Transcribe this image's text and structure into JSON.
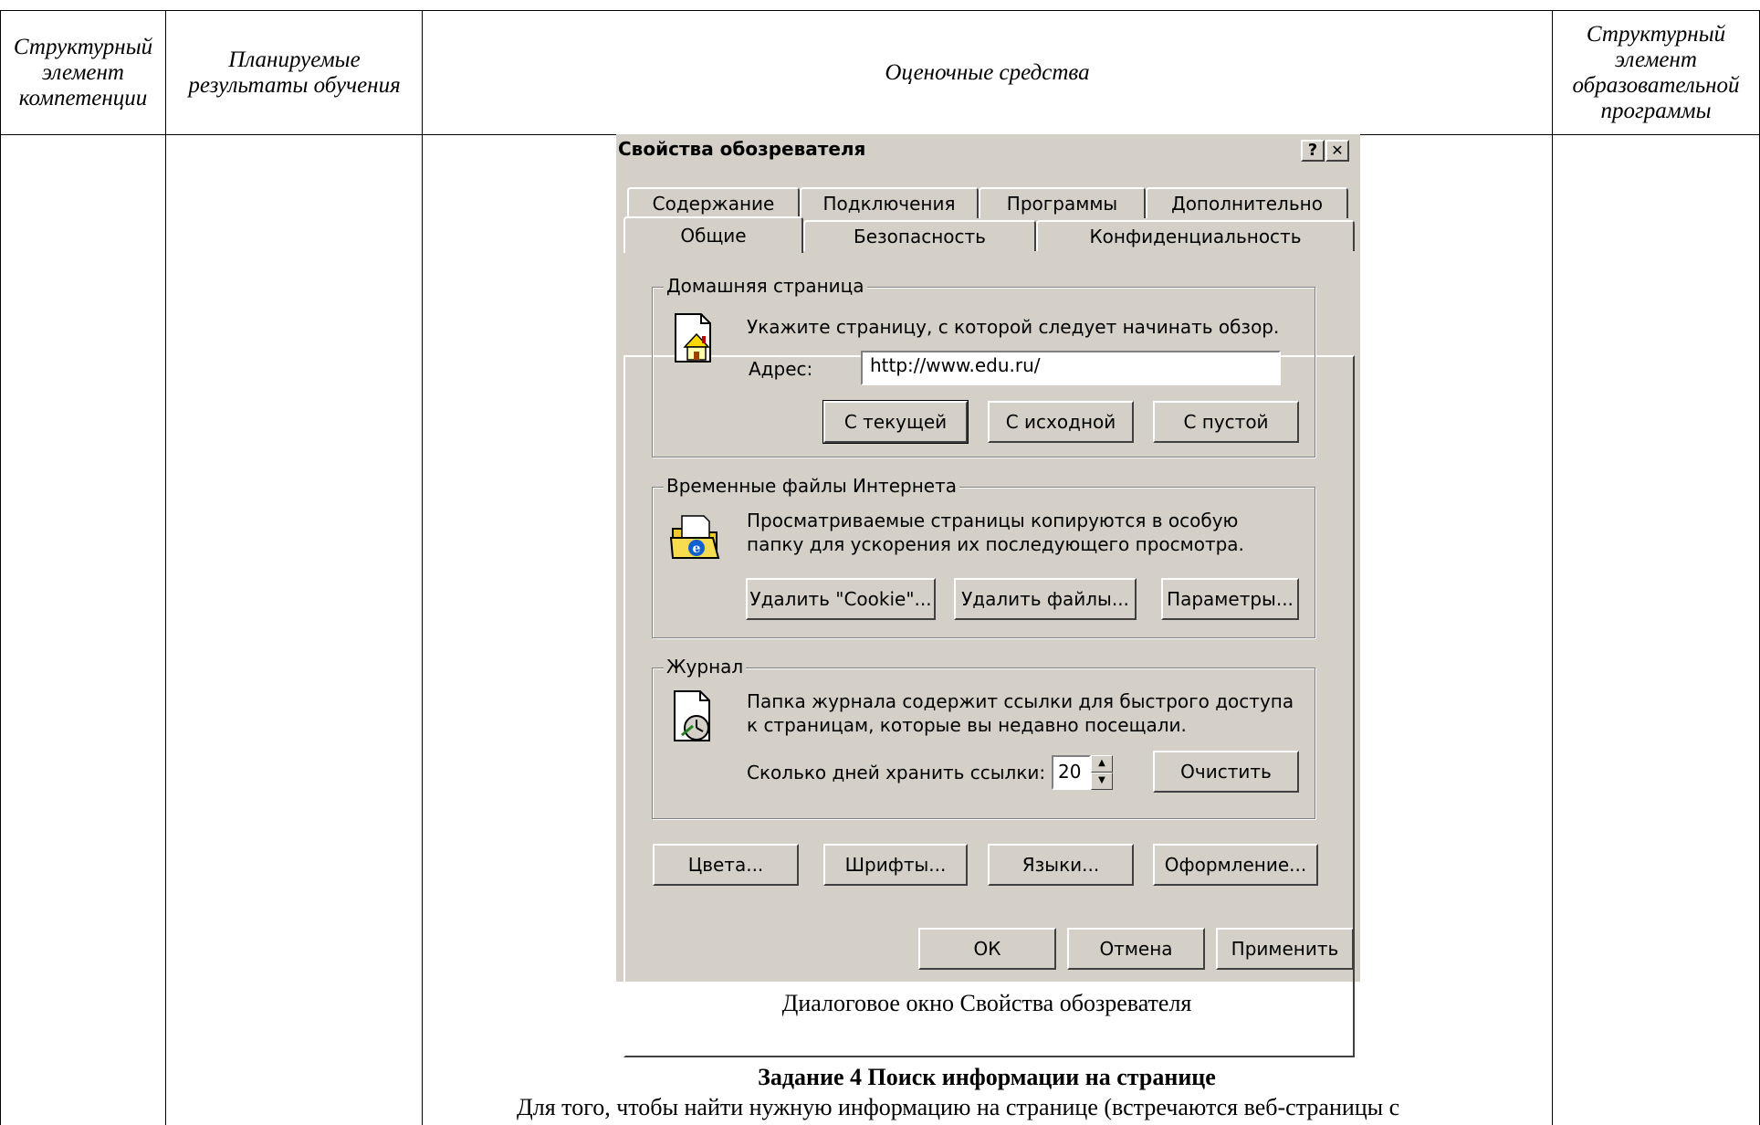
{
  "table": {
    "headers": {
      "col1": "Структурный элемент компетенции",
      "col2": "Планируемые результаты обучения",
      "col3": "Оценочные средства",
      "col4": "Структурный элемент образовательной программы"
    }
  },
  "dialog": {
    "title": "Свойства обозревателя",
    "help_btn": "?",
    "close_btn": "✕",
    "tabs_back": [
      "Содержание",
      "Подключения",
      "Программы",
      "Дополнительно"
    ],
    "tabs_front": [
      "Общие",
      "Безопасность",
      "Конфиденциальность"
    ],
    "home": {
      "legend": "Домашняя страница",
      "desc": "Укажите страницу, с которой следует начинать обзор.",
      "address_label": "Адрес:",
      "address_value": "http://www.edu.ru/",
      "btn_current": "С текущей",
      "btn_default": "С исходной",
      "btn_blank": "С пустой"
    },
    "temp": {
      "legend": "Временные файлы Интернета",
      "desc_line1": "Просматриваемые страницы копируются в особую",
      "desc_line2": "папку для ускорения их последующего просмотра.",
      "btn_cookies": "Удалить \"Cookie\"...",
      "btn_files": "Удалить файлы...",
      "btn_settings": "Параметры..."
    },
    "history": {
      "legend": "Журнал",
      "desc_line1": "Папка журнала содержит ссылки для быстрого доступа",
      "desc_line2": "к страницам, которые вы недавно посещали.",
      "days_label": "Сколько дней хранить ссылки:",
      "days_value": "20",
      "btn_clear": "Очистить"
    },
    "bottom_buttons": {
      "colors": "Цвета...",
      "fonts": "Шрифты...",
      "languages": "Языки...",
      "design": "Оформление..."
    },
    "footer": {
      "ok": "ОК",
      "cancel": "Отмена",
      "apply": "Применить"
    }
  },
  "caption": "Диалоговое окно Свойства обозревателя",
  "task": {
    "title": "Задание 4 Поиск информации на странице",
    "text": "Для того, чтобы найти нужную информацию на странице (встречаются веб-страницы с"
  }
}
